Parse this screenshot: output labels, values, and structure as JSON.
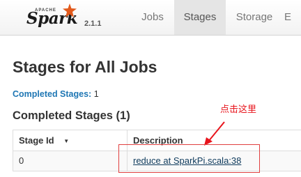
{
  "navbar": {
    "brand": {
      "apache": "APACHE",
      "name": "Spark",
      "version": "2.1.1"
    },
    "tabs": [
      {
        "label": "Jobs",
        "active": false
      },
      {
        "label": "Stages",
        "active": true
      },
      {
        "label": "Storage",
        "active": false
      },
      {
        "label": "E",
        "active": false
      }
    ]
  },
  "page": {
    "title": "Stages for All Jobs",
    "summary": {
      "label": "Completed Stages:",
      "count": "1"
    },
    "section_title": "Completed Stages (1)"
  },
  "table": {
    "headers": {
      "stage_id": "Stage Id",
      "sort_indicator": "▼",
      "description": "Description"
    },
    "rows": [
      {
        "stage_id": "0",
        "description": "reduce at SparkPi.scala:38"
      }
    ]
  },
  "annotation": {
    "text": "点击这里",
    "color": "#e8141c"
  },
  "colors": {
    "spark_orange": "#e25a1c",
    "link_blue": "#1f77b4",
    "active_tab_bg": "#e5e5e5"
  }
}
